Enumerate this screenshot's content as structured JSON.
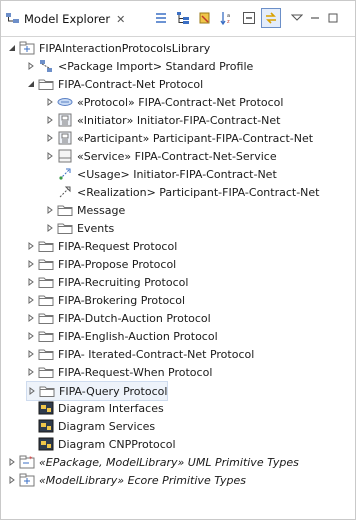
{
  "tab": {
    "title": "Model Explorer",
    "close_glyph": "✕"
  },
  "toolbar": [
    "link-icon",
    "hierarchy-icon",
    "filter-icon",
    "sort-icon",
    "collapse-all-icon",
    "link-with-editor-icon",
    "view-menu-icon",
    "minimize-icon",
    "maximize-icon"
  ],
  "tree": [
    {
      "label": "FIPAInteractionProtocolsLibrary",
      "level": 0,
      "toggle": "expanded",
      "icon": "package-icon"
    },
    {
      "label": "<Package Import> Standard Profile",
      "level": 1,
      "toggle": "collapsed",
      "icon": "package-import-icon"
    },
    {
      "label": "FIPA-Contract-Net Protocol",
      "level": 1,
      "toggle": "expanded",
      "icon": "folder-icon"
    },
    {
      "label": "«Protocol» FIPA-Contract-Net Protocol",
      "level": 2,
      "toggle": "collapsed",
      "icon": "protocol-icon"
    },
    {
      "label": "«Initiator» Initiator-FIPA-Contract-Net",
      "level": 2,
      "toggle": "collapsed",
      "icon": "initiator-icon"
    },
    {
      "label": "«Participant» Participant-FIPA-Contract-Net",
      "level": 2,
      "toggle": "collapsed",
      "icon": "participant-icon"
    },
    {
      "label": "«Service» FIPA-Contract-Net-Service",
      "level": 2,
      "toggle": "collapsed",
      "icon": "service-icon"
    },
    {
      "label": "<Usage> Initiator-FIPA-Contract-Net",
      "level": 2,
      "toggle": "none",
      "icon": "usage-icon"
    },
    {
      "label": "<Realization> Participant-FIPA-Contract-Net",
      "level": 2,
      "toggle": "none",
      "icon": "realization-icon"
    },
    {
      "label": "Message",
      "level": 2,
      "toggle": "collapsed",
      "icon": "folder-icon"
    },
    {
      "label": "Events",
      "level": 2,
      "toggle": "collapsed",
      "icon": "folder-icon"
    },
    {
      "label": "FIPA-Request Protocol",
      "level": 1,
      "toggle": "collapsed",
      "icon": "folder-icon"
    },
    {
      "label": "FIPA-Propose Protocol",
      "level": 1,
      "toggle": "collapsed",
      "icon": "folder-icon"
    },
    {
      "label": "FIPA-Recruiting Protocol",
      "level": 1,
      "toggle": "collapsed",
      "icon": "folder-icon"
    },
    {
      "label": "FIPA-Brokering Protocol",
      "level": 1,
      "toggle": "collapsed",
      "icon": "folder-icon"
    },
    {
      "label": "FIPA-Dutch-Auction Protocol",
      "level": 1,
      "toggle": "collapsed",
      "icon": "folder-icon"
    },
    {
      "label": "FIPA-English-Auction Protocol",
      "level": 1,
      "toggle": "collapsed",
      "icon": "folder-icon"
    },
    {
      "label": "FIPA- Iterated-Contract-Net Protocol",
      "level": 1,
      "toggle": "collapsed",
      "icon": "folder-icon"
    },
    {
      "label": "FIPA-Request-When Protocol",
      "level": 1,
      "toggle": "collapsed",
      "icon": "folder-icon"
    },
    {
      "label": "FIPA-Query Protocol",
      "level": 1,
      "toggle": "collapsed",
      "icon": "folder-icon",
      "selected": true
    },
    {
      "label": "Diagram Interfaces",
      "level": 1,
      "toggle": "none",
      "icon": "diagram-icon"
    },
    {
      "label": "Diagram Services",
      "level": 1,
      "toggle": "none",
      "icon": "diagram-icon"
    },
    {
      "label": "Diagram CNPProtocol",
      "level": 1,
      "toggle": "none",
      "icon": "diagram-icon"
    },
    {
      "label": "«EPackage, ModelLibrary» UML Primitive Types",
      "level": 0,
      "toggle": "collapsed",
      "icon": "epackage-icon",
      "italic": true
    },
    {
      "label": "«ModelLibrary» Ecore Primitive Types",
      "level": 0,
      "toggle": "collapsed",
      "icon": "package-icon",
      "italic": true
    }
  ],
  "colors": {
    "selection": "#eef3fa",
    "folder": "#f3d67a",
    "accent": "#3b6fc4"
  }
}
